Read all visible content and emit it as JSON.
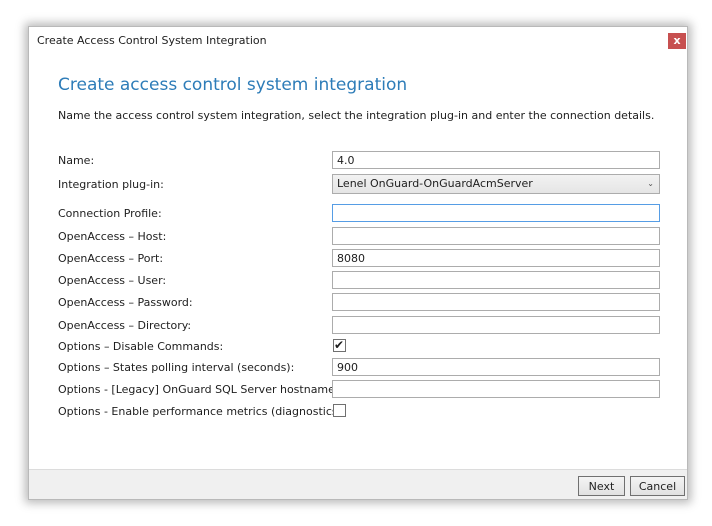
{
  "window": {
    "title": "Create Access Control System Integration",
    "close_glyph": "x"
  },
  "heading": "Create access control system integration",
  "description": "Name the access control system integration, select the integration plug-in and enter the connection details.",
  "fields": {
    "name": {
      "label": "Name:",
      "value": "4.0"
    },
    "plugin": {
      "label": "Integration plug-in:",
      "value": "Lenel OnGuard-OnGuardAcmServer"
    },
    "connection_profile": {
      "label": "Connection Profile:",
      "value": ""
    },
    "host": {
      "label": "OpenAccess – Host:",
      "value": ""
    },
    "port": {
      "label": "OpenAccess – Port:",
      "value": "8080"
    },
    "user": {
      "label": "OpenAccess – User:",
      "value": ""
    },
    "password": {
      "label": "OpenAccess – Password:",
      "value": ""
    },
    "directory": {
      "label": "OpenAccess – Directory:",
      "value": ""
    },
    "disable_commands": {
      "label": "Options – Disable Commands:",
      "checked": true,
      "check_glyph": "✔"
    },
    "polling_interval": {
      "label": "Options – States polling interval (seconds):",
      "value": "900"
    },
    "sql_hostname": {
      "label": "Options - [Legacy] OnGuard SQL Server hostname:",
      "value": ""
    },
    "perf_metrics": {
      "label": "Options - Enable performance metrics (diagnostics):",
      "checked": false
    }
  },
  "buttons": {
    "next": "Next",
    "cancel": "Cancel"
  },
  "colors": {
    "heading": "#2d7cb8",
    "close": "#c75050",
    "focus": "#569de5"
  }
}
